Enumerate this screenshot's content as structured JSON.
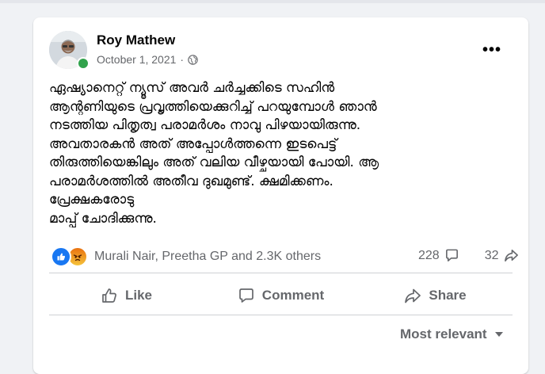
{
  "post": {
    "author": "Roy Mathew",
    "date": "October 1, 2021",
    "separator": "·",
    "audience_icon": "globe-icon",
    "more_icon": "more-options-icon",
    "content_lines": [
      "ഏഷ്യാനെറ്റ് ന്യൂസ് അവർ ചർച്ചക്കിടെ സഹിൻ",
      "ആന്റണിയുടെ പ്രവൃത്തിയെക്കുറിച്ച് പറയുമ്പോൾ ഞാൻ",
      "നടത്തിയ പിതൃത്വ പരാമർശം നാവു പിഴയായിരുന്നു.",
      "അവതാരകൻ അത് അപ്പോൾത്തന്നെ ഇടപെട്ട്",
      "തിരുത്തിയെങ്കിലും അത് വലിയ വീഴ്ചയായി പോയി. ആ",
      "പരാമർശത്തിൽ അതീവ ദുഖമുണ്ട്. ക്ഷമിക്കണം.",
      "പ്രേക്ഷകരോടു",
      "മാപ്പ് ചോദിക്കുന്നു."
    ]
  },
  "reactions": {
    "icons": [
      "like-reaction-icon",
      "angry-reaction-icon"
    ],
    "summary": "Murali Nair, Preetha GP and 2.3K others",
    "comments_count": "228",
    "shares_count": "32"
  },
  "actions": {
    "like": "Like",
    "comment": "Comment",
    "share": "Share"
  },
  "comments": {
    "sort_label": "Most relevant"
  },
  "colors": {
    "like_blue": "#1877f2",
    "online_green": "#31a24c",
    "secondary_text": "#65676b"
  }
}
